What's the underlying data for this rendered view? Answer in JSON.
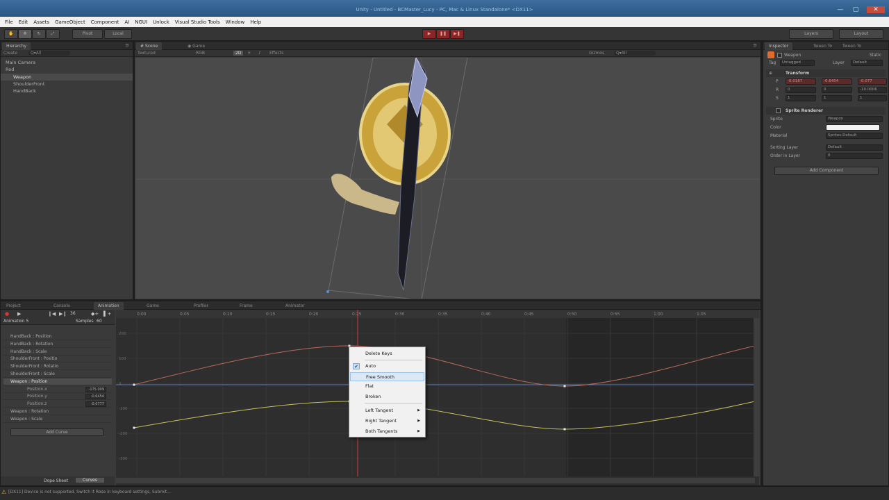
{
  "window": {
    "title": "Unity - Untitled - BCMaster_Lucy - PC, Mac & Linux Standalone* <DX11>",
    "min_label": "—",
    "max_label": "▢",
    "close_label": "✕"
  },
  "menu": [
    "File",
    "Edit",
    "Assets",
    "GameObject",
    "Component",
    "AI",
    "NGUI",
    "Unlock",
    "Visual Studio Tools",
    "Window",
    "Help"
  ],
  "toolbar": {
    "pivot_label": "Pivot",
    "local_label": "Local",
    "layers_label": "Layers",
    "layout_label": "Layout"
  },
  "hierarchy": {
    "tab_label": "Hierarchy",
    "create_label": "Create",
    "search_placeholder": "Q▾All",
    "items": [
      {
        "label": "Main Camera",
        "indent": 0
      },
      {
        "label": "Rod",
        "indent": 0
      },
      {
        "label": "Weapon",
        "indent": 1
      },
      {
        "label": "ShoulderFront",
        "indent": 1
      },
      {
        "label": "HandBack",
        "indent": 1
      }
    ]
  },
  "scene": {
    "tab_scene": "Scene",
    "tab_game": "Game",
    "shading_mode": "Textured",
    "render_mode": "RGB",
    "mode_2d": "2D",
    "effects_label": "Effects",
    "gizmos_label": "Gizmos",
    "search_all": "Q▾All"
  },
  "inspector": {
    "tab_inspector": "Inspector",
    "tab_2": "Tween To",
    "tab_3": "Tween To",
    "object_name": "Weapon",
    "static_label": "Static",
    "tag_label": "Tag",
    "tag_value": "Untagged",
    "layer_label": "Layer",
    "layer_value": "Default",
    "transform_label": "Transform",
    "position_label": "P",
    "position_x": "-0.0187",
    "position_y": "-0.6454",
    "position_z": "-0.077",
    "rotation_label": "R",
    "rotation_x": "0",
    "rotation_y": "0",
    "rotation_z": "-10.0006",
    "scale_label": "S",
    "scale_x": "1",
    "scale_y": "1",
    "scale_z": "1",
    "sprite_renderer_label": "Sprite Renderer",
    "sprite_label": "Sprite",
    "sprite_value": "Weapon",
    "color_label": "Color",
    "material_label": "Material",
    "material_value": "Sprites-Default",
    "sorting_layer_label": "Sorting Layer",
    "sorting_layer_value": "Default",
    "order_label": "Order in Layer",
    "order_value": "0",
    "add_component_label": "Add Component"
  },
  "bottom_tabs": [
    "Project",
    "Console",
    "Animation",
    "Game",
    "Profiler",
    "Frame",
    "Animator"
  ],
  "animation": {
    "clip_name": "Animation 5",
    "samples_label": "Samples",
    "samples_value": "60",
    "frame_value": "36",
    "timeline_ticks": [
      "0:00",
      "0:05",
      "0:10",
      "0:15",
      "0:20",
      "0:25",
      "0:30",
      "0:35",
      "0:40",
      "0:45",
      "0:50",
      "0:55",
      "1:00",
      "1:05"
    ],
    "y_ticks": [
      "200",
      "100",
      "0",
      "-100",
      "-200",
      "-300"
    ],
    "properties": [
      {
        "label": "HandBack : Position",
        "indent": 0,
        "value": "",
        "selected": false
      },
      {
        "label": "HandBack : Rotation",
        "indent": 0,
        "value": "",
        "selected": false
      },
      {
        "label": "HandBack : Scale",
        "indent": 0,
        "value": "",
        "selected": false
      },
      {
        "label": "ShoulderFront : Positio",
        "indent": 0,
        "value": "",
        "selected": false
      },
      {
        "label": "ShoulderFront : Rotatio",
        "indent": 0,
        "value": "",
        "selected": false
      },
      {
        "label": "ShoulderFront : Scale",
        "indent": 0,
        "value": "",
        "selected": false
      },
      {
        "label": "Weapon : Position",
        "indent": 0,
        "value": "",
        "selected": true
      },
      {
        "label": "Position.x",
        "indent": 1,
        "value": "-175.009",
        "selected": false
      },
      {
        "label": "Position.y",
        "indent": 1,
        "value": "-0.6454",
        "selected": false
      },
      {
        "label": "Position.z",
        "indent": 1,
        "value": "-0.0777",
        "selected": false
      },
      {
        "label": "Weapon : Rotation",
        "indent": 0,
        "value": "",
        "selected": false
      },
      {
        "label": "Weapon : Scale",
        "indent": 0,
        "value": "",
        "selected": false
      }
    ],
    "add_curve_label": "Add Curve",
    "dope_sheet_label": "Dope Sheet",
    "curves_label": "Curves"
  },
  "context_menu": {
    "items": [
      {
        "label": "Delete Keys",
        "checked": false,
        "submenu": false,
        "hover": false
      },
      {
        "label": "Auto",
        "checked": true,
        "submenu": false,
        "hover": false
      },
      {
        "label": "Free Smooth",
        "checked": false,
        "submenu": false,
        "hover": true
      },
      {
        "label": "Flat",
        "checked": false,
        "submenu": false,
        "hover": false
      },
      {
        "label": "Broken",
        "checked": false,
        "submenu": false,
        "hover": false
      },
      {
        "label": "Left Tangent",
        "checked": false,
        "submenu": true,
        "hover": false
      },
      {
        "label": "Right Tangent",
        "checked": false,
        "submenu": true,
        "hover": false
      },
      {
        "label": "Both Tangents",
        "checked": false,
        "submenu": true,
        "hover": false
      }
    ]
  },
  "status_bar": {
    "message": "[DX11] Device is not supported. Switch it Rose in keyboard settings, Submit..."
  },
  "colors": {
    "curve_x": "#b96a5b",
    "curve_y": "#c8c45e",
    "curve_z": "#5e7fb9",
    "playhead": "#d33b3b",
    "selection": "#4c4c4c"
  }
}
